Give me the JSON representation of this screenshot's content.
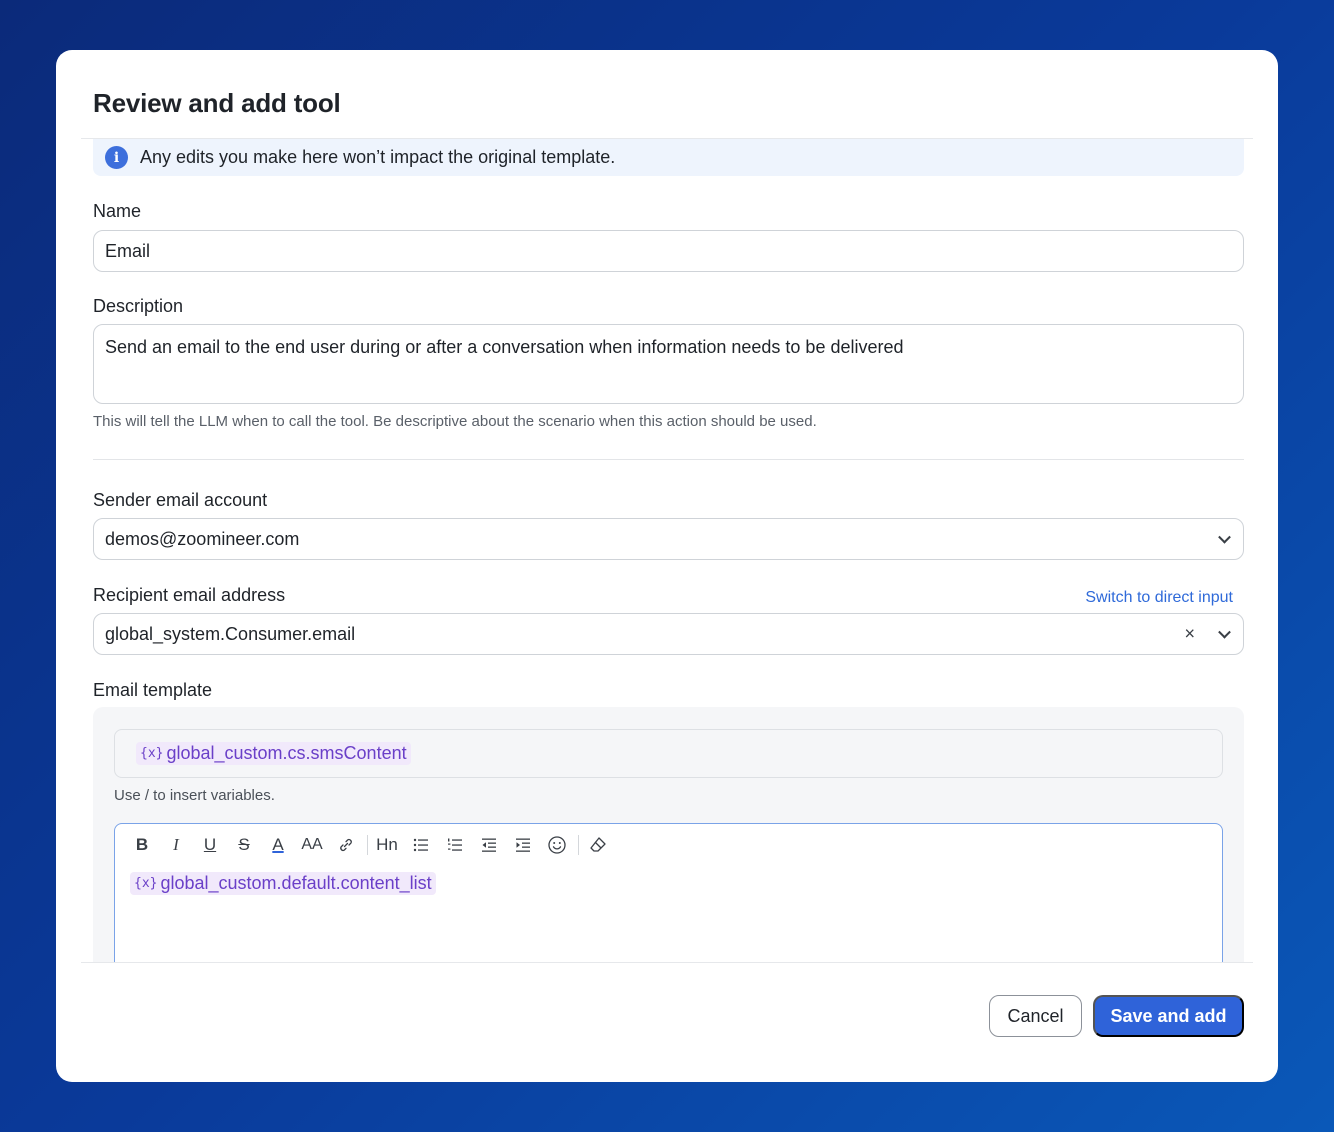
{
  "modal": {
    "title": "Review and add tool",
    "info_banner": "Any edits you make here won’t impact the original template."
  },
  "form": {
    "name": {
      "label": "Name",
      "value": "Email"
    },
    "description": {
      "label": "Description",
      "value": "Send an email to the end user during or after a conversation when information needs to be delivered",
      "helper": "This will tell the LLM when to call the tool. Be descriptive about the scenario when this action should be used."
    },
    "sender": {
      "label": "Sender email account",
      "value": "demos@zoomineer.com"
    },
    "recipient": {
      "label": "Recipient email address",
      "value": "global_system.Consumer.email",
      "switch_link": "Switch to direct input",
      "clear_glyph": "×"
    },
    "template": {
      "label": "Email template",
      "var_prefix": "{x}",
      "subject_variable": "global_custom.cs.smsContent",
      "helper": "Use / to insert variables.",
      "body_variable": "global_custom.default.content_list",
      "toolbar": {
        "bold": "B",
        "italic": "I",
        "underline": "U",
        "strike": "S",
        "font_color": "A",
        "font_size": "AA",
        "heading": "Hn"
      }
    }
  },
  "footer": {
    "cancel_label": "Cancel",
    "save_label": "Save and add"
  },
  "colors": {
    "primary": "#2f63d9",
    "link": "#2f6ad9",
    "variable": "#6a3fc8",
    "info_bg": "#eef4fd"
  }
}
